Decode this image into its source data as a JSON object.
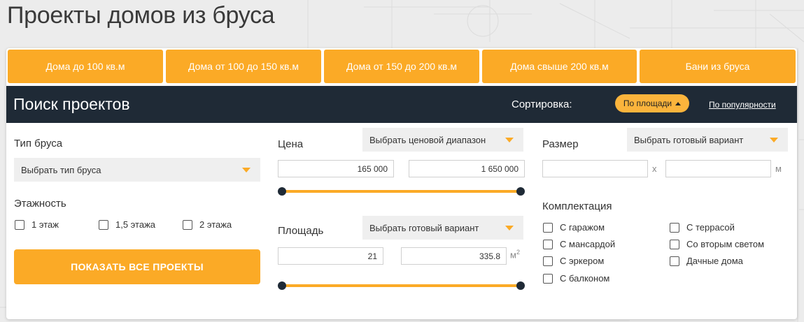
{
  "page_title": "Проекты домов из бруса",
  "tabs": [
    "Дома до 100 кв.м",
    "Дома от 100 до 150 кв.м",
    "Дома от 150 до 200 кв.м",
    "Дома свыше 200 кв.м",
    "Бани из бруса"
  ],
  "search": {
    "title": "Поиск проектов",
    "sort_label": "Сортировка:",
    "sort_active": "По площади",
    "sort_other": "По популярности"
  },
  "timber": {
    "label": "Тип бруса",
    "select": "Выбрать тип бруса"
  },
  "floors": {
    "label": "Этажность",
    "options": [
      "1 этаж",
      "1,5 этажа",
      "2 этажа"
    ]
  },
  "show_button": "ПОКАЗАТЬ ВСЕ ПРОЕКТЫ",
  "price": {
    "label": "Цена",
    "select": "Выбрать ценовой диапазон",
    "min": "165 000",
    "max": "1 650 000"
  },
  "area": {
    "label": "Площадь",
    "select": "Выбрать готовый вариант",
    "min": "21",
    "max": "335.8",
    "unit": "м",
    "unit_sup": "2"
  },
  "size": {
    "label": "Размер",
    "select": "Выбрать готовый вариант",
    "width": "",
    "length": "",
    "separator": "x",
    "unit": "м"
  },
  "equipment": {
    "label": "Комплектация",
    "col1": [
      "С гаражом",
      "С мансардой",
      "С эркером",
      "С балконом"
    ],
    "col2": [
      "С террасой",
      "Со вторым светом",
      "Дачные дома"
    ]
  },
  "colors": {
    "accent": "#fbaa26",
    "dark": "#1f2a36",
    "background": "#ececec"
  }
}
